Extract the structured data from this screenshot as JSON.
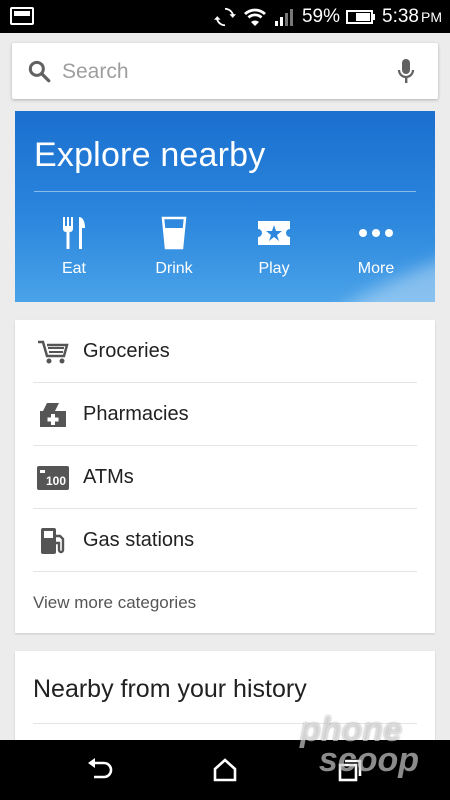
{
  "status_bar": {
    "battery_percent": "59%",
    "time": "5:38",
    "ampm": "PM",
    "icons": [
      "notification-icon",
      "sync-icon",
      "wifi-icon",
      "signal-icon",
      "battery-icon"
    ]
  },
  "search": {
    "placeholder": "Search",
    "icons": [
      "search-icon",
      "mic-icon"
    ]
  },
  "explore": {
    "title": "Explore nearby",
    "categories": [
      {
        "label": "Eat",
        "icon": "fork-knife-icon"
      },
      {
        "label": "Drink",
        "icon": "glass-icon"
      },
      {
        "label": "Play",
        "icon": "ticket-icon"
      },
      {
        "label": "More",
        "icon": "more-dots-icon"
      }
    ],
    "bg_color": "#2b86dd"
  },
  "categories": {
    "items": [
      {
        "label": "Groceries",
        "icon": "cart-icon"
      },
      {
        "label": "Pharmacies",
        "icon": "pharmacy-icon"
      },
      {
        "label": "ATMs",
        "icon": "atm-icon"
      },
      {
        "label": "Gas stations",
        "icon": "gas-pump-icon"
      }
    ],
    "more_label": "View more categories"
  },
  "history": {
    "title": "Nearby from your history"
  },
  "nav": {
    "icons": [
      "back-icon",
      "home-icon",
      "recents-icon"
    ]
  },
  "watermark": {
    "text": "phone scoop"
  }
}
